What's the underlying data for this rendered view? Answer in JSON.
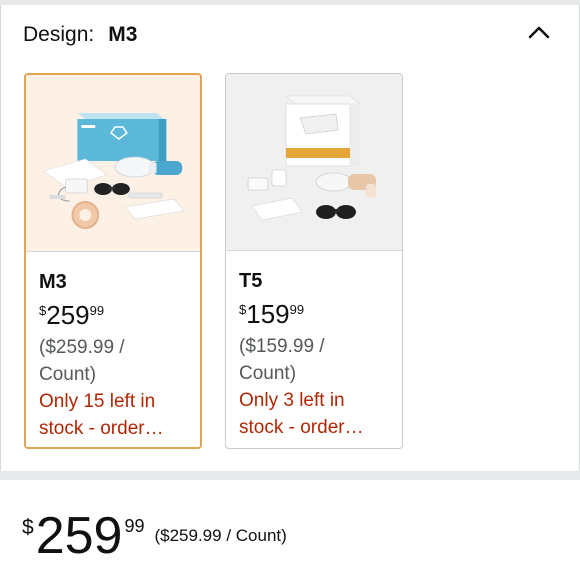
{
  "design": {
    "label": "Design:",
    "selected": "M3",
    "collapse_icon": "chevron-up-icon"
  },
  "options": [
    {
      "name": "M3",
      "price_symbol": "$",
      "price_whole": "259",
      "price_fraction": "99",
      "unit_line1": "($259.99 /",
      "unit_line2": "Count)",
      "stock_line1": "Only 15 left in",
      "stock_line2": "stock - order…",
      "selected": true,
      "image_icon": "product-image-m3",
      "image_bg": "#fdf0e5"
    },
    {
      "name": "T5",
      "price_symbol": "$",
      "price_whole": "159",
      "price_fraction": "99",
      "unit_line1": "($159.99 /",
      "unit_line2": "Count)",
      "stock_line1": "Only 3 left in",
      "stock_line2": "stock - order…",
      "selected": false,
      "image_icon": "product-image-t5",
      "image_bg": "#f0f0f1"
    }
  ],
  "main_price": {
    "symbol": "$",
    "whole": "259",
    "fraction": "99",
    "unit": "($259.99 / Count)"
  },
  "colors": {
    "selected_border": "#e3a450",
    "stock_red": "#b12704",
    "muted_text": "#565959"
  }
}
